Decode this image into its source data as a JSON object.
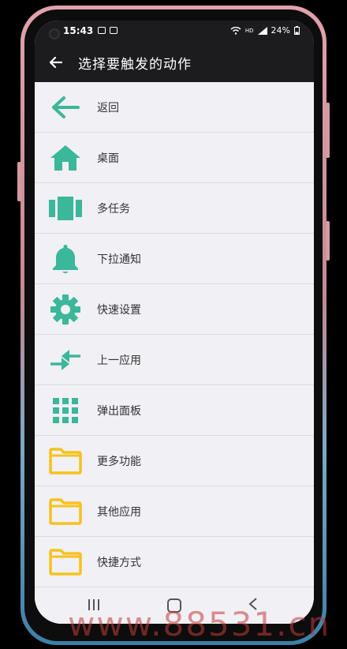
{
  "status_bar": {
    "time": "15:43",
    "battery": "24%",
    "network": "HD"
  },
  "app_bar": {
    "title": "选择要触发的动作"
  },
  "colors": {
    "accent_green": "#3bb79a",
    "folder_yellow": "#f6c21c",
    "app_bar_bg": "#1c1c1e",
    "list_bg": "#f1f0f5"
  },
  "actions": [
    {
      "label": "返回",
      "icon": "arrow-left-icon"
    },
    {
      "label": "桌面",
      "icon": "home-icon"
    },
    {
      "label": "多任务",
      "icon": "multitask-icon"
    },
    {
      "label": "下拉通知",
      "icon": "bell-icon"
    },
    {
      "label": "快速设置",
      "icon": "gear-icon"
    },
    {
      "label": "上一应用",
      "icon": "swap-arrows-icon"
    },
    {
      "label": "弹出面板",
      "icon": "grid-icon"
    },
    {
      "label": "更多功能",
      "icon": "folder-icon"
    },
    {
      "label": "其他应用",
      "icon": "folder-icon"
    },
    {
      "label": "快捷方式",
      "icon": "folder-icon"
    }
  ],
  "nav_bar": {
    "recent": "recents-icon",
    "home": "home-nav-icon",
    "back": "back-nav-icon"
  },
  "watermark": "www.88531.cn"
}
